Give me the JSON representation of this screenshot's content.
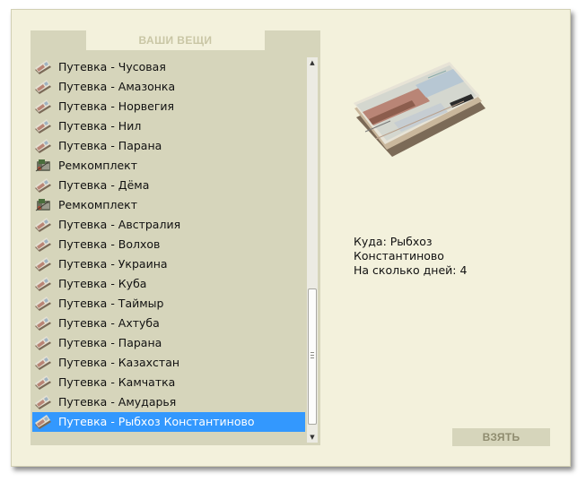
{
  "panel": {
    "title": "ВАШИ ВЕЩИ"
  },
  "items": [
    {
      "label": "Путевка - Чусовая",
      "icon": "ticket-icon"
    },
    {
      "label": "Путевка - Амазонка",
      "icon": "ticket-icon"
    },
    {
      "label": "Путевка - Норвегия",
      "icon": "ticket-icon"
    },
    {
      "label": "Путевка - Нил",
      "icon": "ticket-icon"
    },
    {
      "label": "Путевка - Парана",
      "icon": "ticket-icon"
    },
    {
      "label": "Ремкомплект",
      "icon": "repair-kit-icon"
    },
    {
      "label": "Путевка - Дёма",
      "icon": "ticket-icon"
    },
    {
      "label": "Ремкомплект",
      "icon": "repair-kit-icon"
    },
    {
      "label": "Путевка - Австралия",
      "icon": "ticket-icon"
    },
    {
      "label": "Путевка - Волхов",
      "icon": "ticket-icon"
    },
    {
      "label": "Путевка - Украина",
      "icon": "ticket-icon"
    },
    {
      "label": "Путевка - Куба",
      "icon": "ticket-icon"
    },
    {
      "label": "Путевка - Таймыр",
      "icon": "ticket-icon"
    },
    {
      "label": "Путевка - Ахтуба",
      "icon": "ticket-icon"
    },
    {
      "label": "Путевка - Парана",
      "icon": "ticket-icon"
    },
    {
      "label": "Путевка - Казахстан",
      "icon": "ticket-icon"
    },
    {
      "label": "Путевка - Камчатка",
      "icon": "ticket-icon"
    },
    {
      "label": "Путевка - Амударья",
      "icon": "ticket-icon"
    },
    {
      "label": "Путевка - Рыбхоз Константиново",
      "icon": "ticket-icon",
      "selected": true
    }
  ],
  "details": {
    "line1": "Куда: Рыбхоз",
    "line2": "Константиново",
    "line3": "На сколько дней: 4"
  },
  "actions": {
    "take_label": "ВЗЯТЬ"
  },
  "scrollbar": {
    "up_glyph": "▲",
    "down_glyph": "▼"
  },
  "colors": {
    "selection": "#3398fe",
    "panel": "#d6d5bb",
    "background": "#f3f1dc"
  }
}
